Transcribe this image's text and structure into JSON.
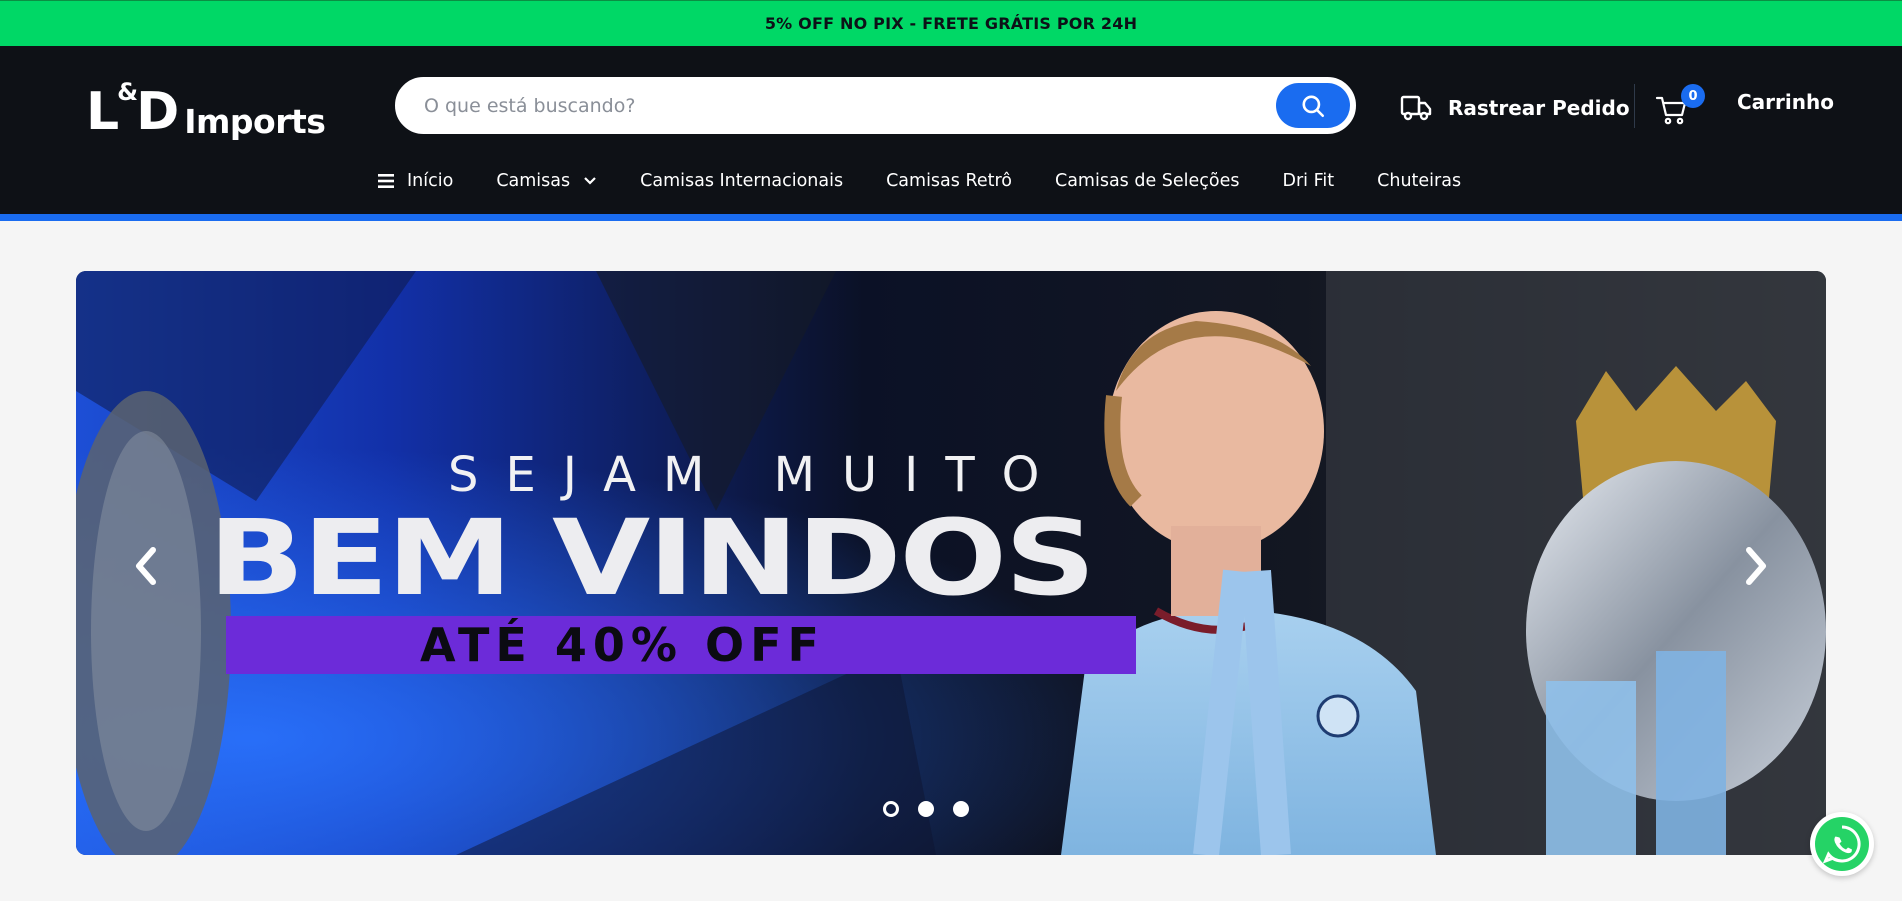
{
  "promo_bar": {
    "text": "5% OFF NO PIX - FRETE GRÁTIS POR 24H"
  },
  "header": {
    "logo": {
      "main": "L",
      "amp": "&",
      "main2": "D",
      "sub": "Imports"
    },
    "search": {
      "placeholder": "O que está buscando?",
      "value": ""
    },
    "track_order_label": "Rastrear Pedido",
    "cart": {
      "count": "0",
      "label": "Carrinho"
    }
  },
  "nav": {
    "items": [
      {
        "label": "Início"
      },
      {
        "label": "Camisas"
      },
      {
        "label": "Camisas Internacionais"
      },
      {
        "label": "Camisas Retrô"
      },
      {
        "label": "Camisas de Seleções"
      },
      {
        "label": "Dri Fit"
      },
      {
        "label": "Chuteiras"
      }
    ]
  },
  "hero": {
    "line1": "SEJAM MUITO",
    "line2": "BEM VINDOS",
    "discount": "ATÉ 40% OFF",
    "slides_total": 3,
    "active_slide": 1
  },
  "colors": {
    "promo_green": "#00d866",
    "header_bg": "#0e1116",
    "accent_blue": "#1a6cf0",
    "strip_purple": "#6c2bd9",
    "whatsapp_green": "#25d366"
  },
  "icons": [
    "menu-icon",
    "chevron-down-icon",
    "search-icon",
    "truck-icon",
    "cart-icon",
    "chevron-left-icon",
    "chevron-right-icon",
    "whatsapp-icon"
  ]
}
